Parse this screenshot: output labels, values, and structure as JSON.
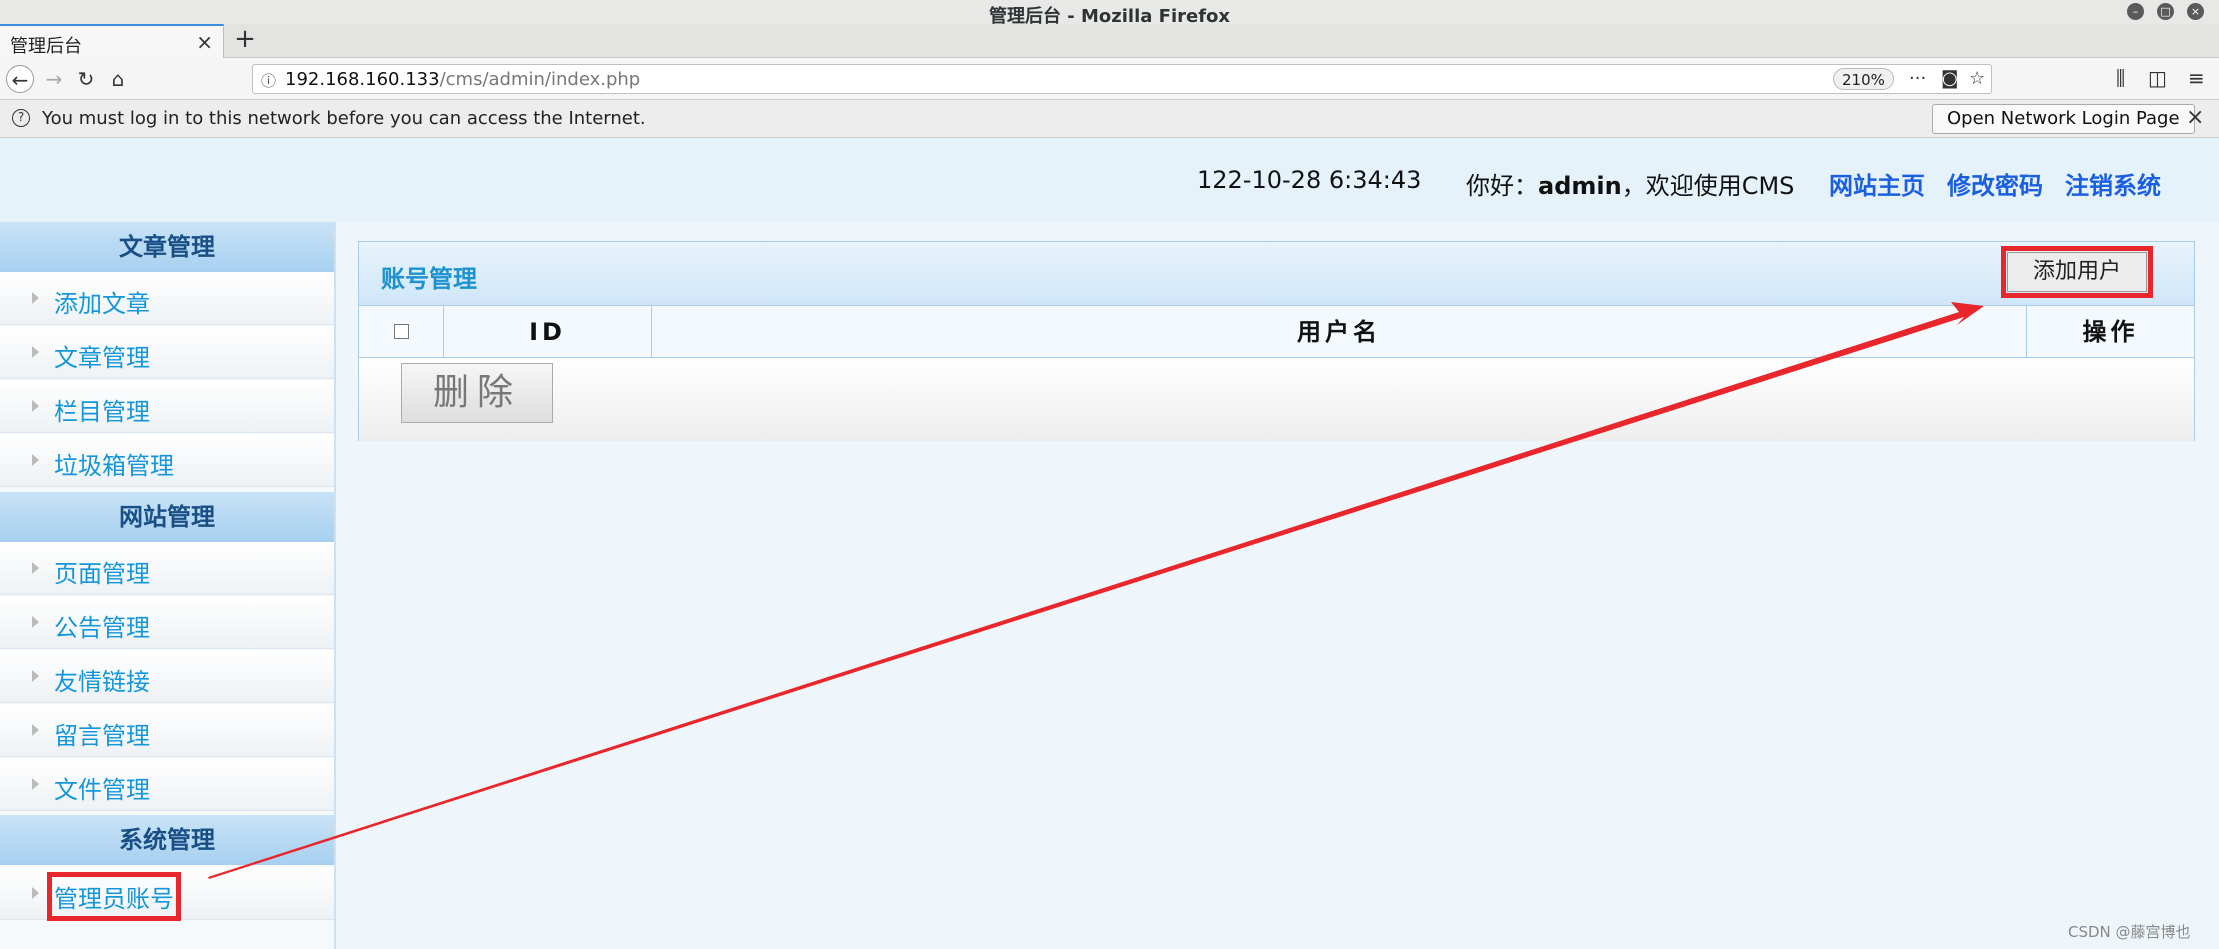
{
  "window": {
    "title": "管理后台 - Mozilla Firefox",
    "controls": [
      "minimize-icon",
      "maximize-icon",
      "close-icon"
    ]
  },
  "tab": {
    "label": "管理后台",
    "close": "×",
    "new_tab": "+"
  },
  "navbar": {
    "url_host": "192.168.160.133",
    "url_path": "/cms/admin/index.php",
    "zoom": "210%",
    "icons": [
      "back-icon",
      "forward-icon",
      "reload-icon",
      "home-icon",
      "info-icon",
      "more-icon",
      "pocket-icon",
      "bookmark-star-icon",
      "library-icon",
      "sidebar-icon",
      "menu-icon"
    ]
  },
  "notification": {
    "text": "You must log in to this network before you can access the Internet.",
    "button": "Open Network Login Page",
    "close": "×"
  },
  "header": {
    "datetime": "122-10-28 6:34:43",
    "greeting_prefix": "你好：",
    "username": "admin",
    "greeting_suffix": "，欢迎使用CMS",
    "links": [
      "网站主页",
      "修改密码",
      "注销系统"
    ]
  },
  "sidebar": {
    "sections": [
      {
        "title": "文章管理",
        "items": [
          "添加文章",
          "文章管理",
          "栏目管理",
          "垃圾箱管理"
        ]
      },
      {
        "title": "网站管理",
        "items": [
          "页面管理",
          "公告管理",
          "友情链接",
          "留言管理",
          "文件管理"
        ]
      },
      {
        "title": "系统管理",
        "items": [
          "管理员账号"
        ]
      }
    ]
  },
  "panel": {
    "title": "账号管理",
    "add_button": "添加用户",
    "columns": [
      "ID",
      "用户名",
      "操作"
    ],
    "delete_button": "删除"
  },
  "annotation": {
    "color": "#e8262b"
  },
  "watermark": "CSDN @藤宫博也"
}
